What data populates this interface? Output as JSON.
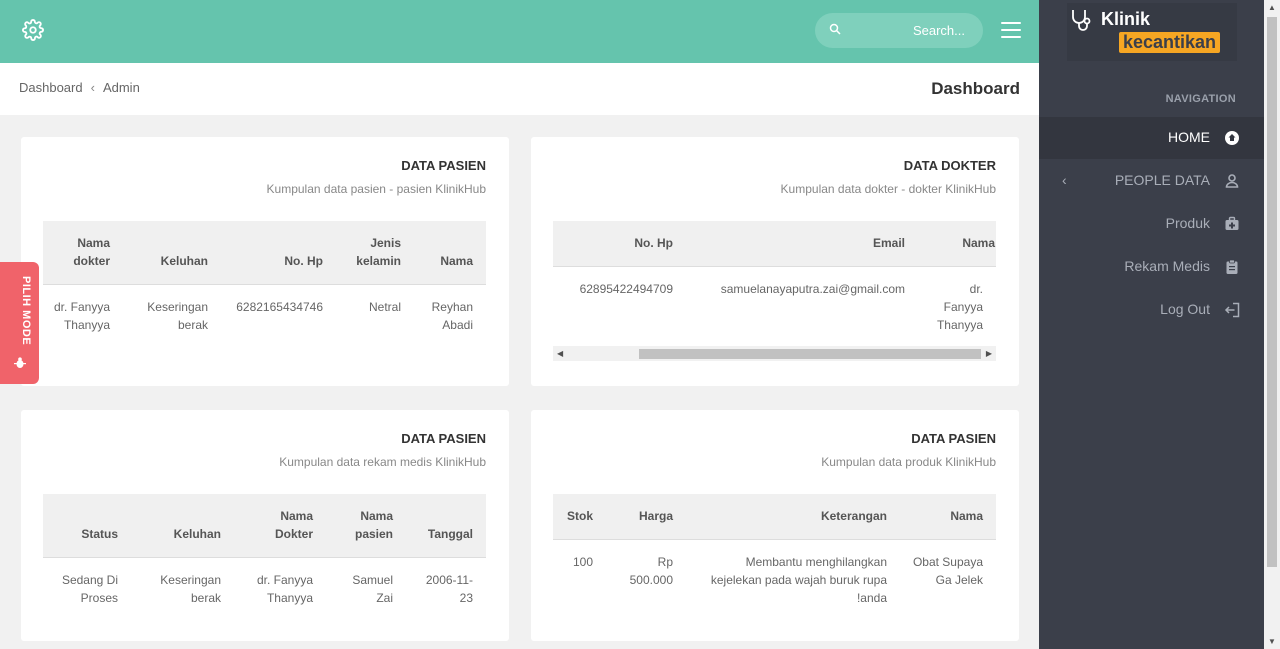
{
  "topbar": {
    "search_placeholder": "Search..."
  },
  "breadcrumb": {
    "items": [
      "Dashboard",
      "Admin"
    ],
    "page_title": "Dashboard"
  },
  "mode_tab": {
    "label": "PILIH MODE"
  },
  "sidebar": {
    "logo_line1": "Klinik",
    "logo_line2": "kecantikan",
    "nav_heading": "NAVIGATION",
    "items": [
      {
        "label": "HOME",
        "icon": "home-icon",
        "active": true
      },
      {
        "label": "PEOPLE DATA",
        "icon": "user-icon"
      },
      {
        "label": "Produk",
        "icon": "medkit-icon"
      },
      {
        "label": "Rekam Medis",
        "icon": "clipboard-icon"
      },
      {
        "label": "Log Out",
        "icon": "logout-icon"
      }
    ]
  },
  "cards": {
    "pasien": {
      "title": "DATA PASIEN",
      "subtitle": "Kumpulan data pasien - pasien KlinikHub",
      "headers": [
        "Nama dokter",
        "Keluhan",
        "No. Hp",
        "Jenis kelamin",
        "Nama"
      ],
      "rows": [
        [
          "dr. Fanyya Thanyya",
          "Keseringan berak",
          "6282165434746",
          "Netral",
          "Reyhan Abadi"
        ]
      ]
    },
    "dokter": {
      "title": "DATA DOKTER",
      "subtitle": "Kumpulan data dokter - dokter KlinikHub",
      "headers": [
        "No. Hp",
        "Email",
        "Nama"
      ],
      "rows": [
        [
          "62895422494709",
          "samuelanayaputra.zai@gmail.com",
          "dr. Fanyya Thanyya"
        ]
      ]
    },
    "rekam": {
      "title": "DATA PASIEN",
      "subtitle": "Kumpulan data rekam medis KlinikHub",
      "headers": [
        "Status",
        "Keluhan",
        "Nama Dokter",
        "Nama pasien",
        "Tanggal"
      ],
      "rows": [
        [
          "Sedang Di Proses",
          "Keseringan berak",
          "dr. Fanyya Thanyya",
          "Samuel Zai",
          "2006-11-23"
        ]
      ]
    },
    "produk": {
      "title": "DATA PASIEN",
      "subtitle": "Kumpulan data produk KlinikHub",
      "headers": [
        "Stok",
        "Harga",
        "Keterangan",
        "Nama"
      ],
      "rows": [
        [
          "100",
          "Rp 500.000",
          "Membantu menghilangkan kejelekan pada wajah buruk rupa anda!",
          "Obat Supaya Ga Jelek"
        ]
      ]
    }
  },
  "colors": {
    "topbar": "#65c4ad",
    "sidebar": "#3b3f4a",
    "mode_tab": "#f0636a",
    "logo_accent": "#f6a623"
  }
}
